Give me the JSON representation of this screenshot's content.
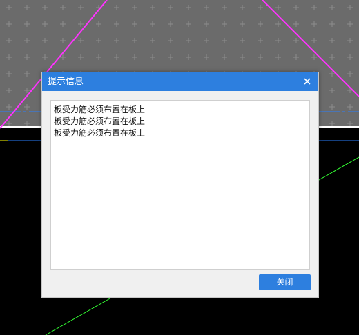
{
  "dialog": {
    "title": "提示信息",
    "close_icon": "close-icon",
    "messages": [
      "板受力筋必须布置在板上",
      "板受力筋必须布置在板上",
      "板受力筋必须布置在板上"
    ],
    "close_button_label": "关闭"
  },
  "colors": {
    "titlebar": "#2d7fdf",
    "dialog_body": "#f0f0f0",
    "cad_background": "#000000",
    "cad_grid_area": "#6b6b6b",
    "magenta_line": "#ff33ff",
    "green_line": "#33ff33",
    "blue_line": "#2a7fff",
    "yellow_mark": "#ffff00"
  }
}
